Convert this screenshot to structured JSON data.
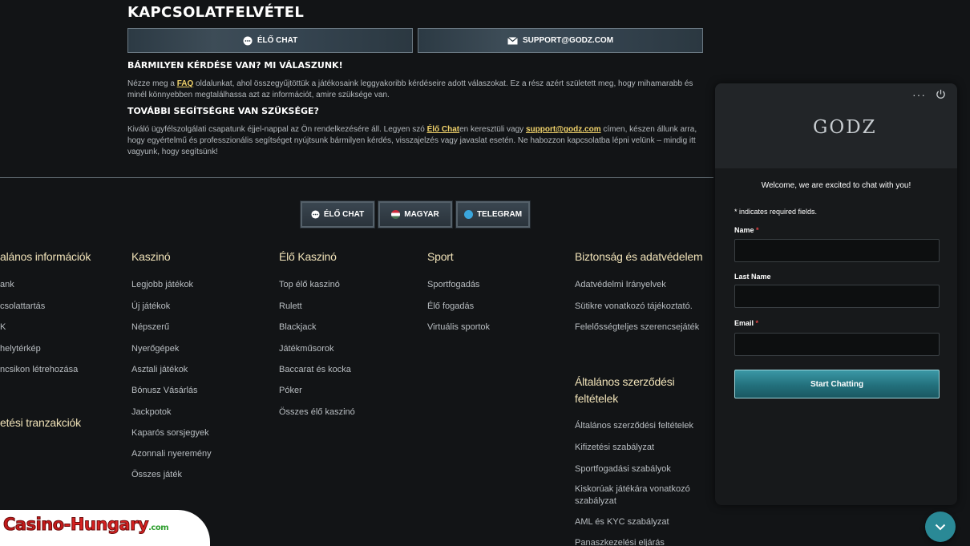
{
  "contact": {
    "title": "KAPCSOLATFELVÉTEL",
    "live_chat_label": "ÉLŐ CHAT",
    "email_label": "SUPPORT@GODZ.COM",
    "q1_heading": "BÁRMILYEN KÉRDÉSE VAN? MI VÁLASZUNK!",
    "q1_before": "Nézze meg a ",
    "q1_link": "FAQ",
    "q1_after": " oldalunkat, ahol összegyűjtöttük a játékosaink leggyakoribb kérdéseire adott válaszokat. Ez a rész azért született meg, hogy mihamarabb és minél könnyebben megtalálhassa azt az információt, amire szüksége van.",
    "q2_heading": "TOVÁBBI SEGÍTSÉGRE VAN SZÜKSÉGE?",
    "q2_before": "Kiváló ügyfélszolgálati csapatunk éjjel-nappal az Ön rendelkezésére áll. Legyen szó ",
    "q2_link1": "Élő Chat",
    "q2_mid": "en keresztüli vagy ",
    "q2_link2": "support@godz.com",
    "q2_after": " címen, készen állunk arra, hogy egyértelmű és professzionális segítséget nyújtsunk bármilyen kérdés, visszajelzés vagy javaslat esetén. Ne habozzon kapcsolatba lépni velünk – mindig itt vagyunk, hogy segítsünk!"
  },
  "footer_buttons": {
    "live_chat": "ÉLŐ CHAT",
    "language": "MAGYAR",
    "telegram": "TELEGRAM"
  },
  "footer": {
    "general": {
      "title": "alános információk",
      "items": [
        "ank",
        "csolattartás",
        "K",
        "helytérkép",
        "ncsikon létrehozása"
      ]
    },
    "transactions_title": "etési tranzakciók",
    "casino": {
      "title": "Kaszinó",
      "items": [
        "Legjobb játékok",
        "Új játékok",
        "Népszerű",
        "Nyerőgépek",
        "Asztali játékok",
        "Bónusz Vásárlás",
        "Jackpotok",
        "Kaparós sorsjegyek",
        "Azonnali nyeremény",
        "Összes játék"
      ]
    },
    "live_casino": {
      "title": "Élő Kaszinó",
      "items": [
        "Top élő kaszinó",
        "Rulett",
        "Blackjack",
        "Játékműsorok",
        "Baccarat és kocka",
        "Póker",
        "Összes élő kaszinó"
      ]
    },
    "sport": {
      "title": "Sport",
      "items": [
        "Sportfogadás",
        "Élő fogadás",
        "Virtuális sportok"
      ]
    },
    "security": {
      "title": "Biztonság és adatvédelem",
      "items": [
        "Adatvédelmi Irányelvek",
        "Sütikre vonatkozó tájékoztató.",
        "Felelősségteljes szerencsejáték"
      ]
    },
    "terms": {
      "title_line1": "Általános szerződési",
      "title_line2": "feltételek",
      "items": [
        "Általános szerződési feltételek",
        "Kifizetési szabályzat",
        "Sportfogadási szabályok",
        "Kiskorúak játékára vonatkozó",
        "szabályzat",
        "AML és KYC szabályzat",
        "Panaszkezelési eljárás"
      ]
    }
  },
  "chat": {
    "menu": "···",
    "logo": "GODZ",
    "welcome": "Welcome, we are excited to chat with you!",
    "required_note": "* indicates required fields.",
    "name_label": "Name",
    "last_name_label": "Last Name",
    "email_label": "Email",
    "required_mark": "*",
    "start_button": "Start Chatting"
  },
  "watermark": {
    "part1": "Casino",
    "part2": "-Hungary",
    "part3": ".com"
  },
  "colors": {
    "accent_gold": "#f1d36b",
    "chat_button": "#23707c",
    "background": "#121416"
  }
}
